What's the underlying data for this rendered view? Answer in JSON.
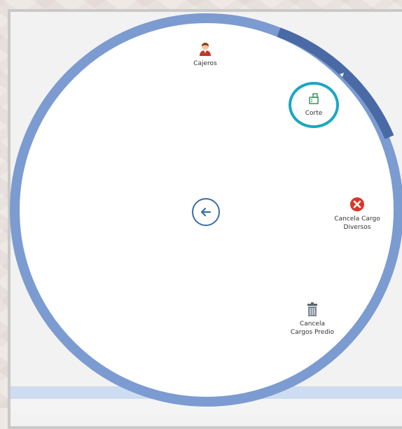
{
  "menu": {
    "items": [
      {
        "id": "cajeros",
        "label": "Cajeros",
        "icon": "cashier-person-icon"
      },
      {
        "id": "corte",
        "label": "Corte",
        "icon": "cash-register-icon"
      },
      {
        "id": "cancela_cargo_diversos",
        "label": "Cancela Cargo\nDiversos",
        "icon": "cancel-x-icon"
      },
      {
        "id": "cancela_cargos_predio",
        "label": "Cancela\nCargos Predio",
        "icon": "trash-can-icon"
      }
    ],
    "back_icon": "back-arrow-icon",
    "highlighted_item": "Corte"
  },
  "colors": {
    "ring": "#7b9bd1",
    "ring_segment_active": "#4a6aa6",
    "highlight": "#1aa7c2",
    "panel_band": "#cddcf0"
  }
}
